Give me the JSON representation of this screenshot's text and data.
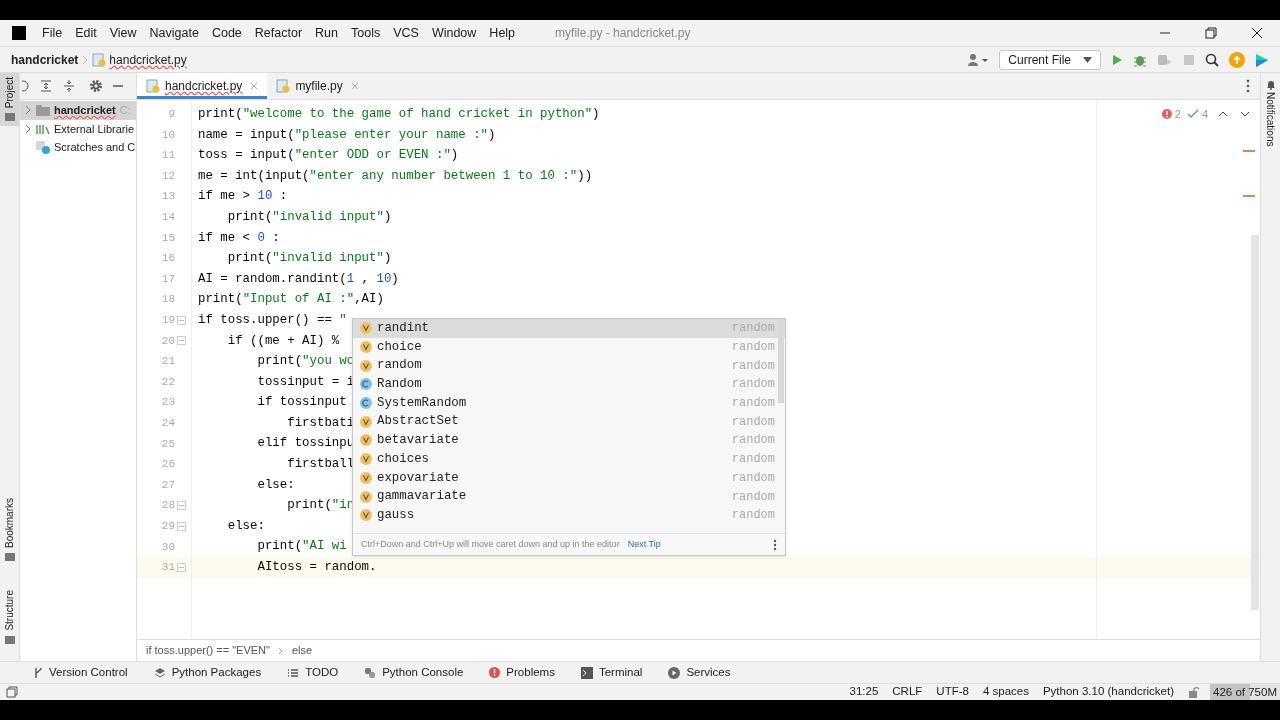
{
  "menu": [
    "File",
    "Edit",
    "View",
    "Navigate",
    "Code",
    "Refactor",
    "Run",
    "Tools",
    "VCS",
    "Window",
    "Help"
  ],
  "window": {
    "title": "myfile.py - handcricket.py"
  },
  "navbar": {
    "project": "handcricket",
    "file": "handcricket.py",
    "run_config": "Current File"
  },
  "left_stripe": [
    "Project",
    "Bookmarks",
    "Structure"
  ],
  "right_stripe": [
    "Notifications"
  ],
  "project_tree": [
    {
      "label": "handcricket",
      "suffix": "C:",
      "kind": "folder",
      "expanded": false,
      "selected": true
    },
    {
      "label": "External Librarie",
      "kind": "libs",
      "expanded": false,
      "selected": false
    },
    {
      "label": "Scratches and C",
      "kind": "scratch",
      "selected": false
    }
  ],
  "tabs": [
    {
      "label": "handcricket.py",
      "selected": true
    },
    {
      "label": "myfile.py",
      "selected": false
    }
  ],
  "inspections": {
    "errors": "2",
    "warnings": "4"
  },
  "code": [
    {
      "n": "9",
      "fold": false,
      "current": false,
      "tokens": [
        {
          "t": "print(",
          "kind": "plain"
        },
        {
          "t": "\"welcome to the game of hand cricket in python\"",
          "kind": "string"
        },
        {
          "t": ")",
          "kind": "plain"
        }
      ]
    },
    {
      "n": "10",
      "fold": false,
      "current": false,
      "tokens": [
        {
          "t": "name = input(",
          "kind": "plain"
        },
        {
          "t": "\"please enter your name :\"",
          "kind": "string"
        },
        {
          "t": ")",
          "kind": "plain"
        }
      ]
    },
    {
      "n": "11",
      "fold": false,
      "current": false,
      "tokens": [
        {
          "t": "toss = input(",
          "kind": "plain"
        },
        {
          "t": "\"enter ODD or EVEN :\"",
          "kind": "string"
        },
        {
          "t": ")",
          "kind": "plain"
        }
      ]
    },
    {
      "n": "12",
      "fold": false,
      "current": false,
      "tokens": [
        {
          "t": "me = int(input(",
          "kind": "plain"
        },
        {
          "t": "\"enter any number between 1 to 10 :\"",
          "kind": "string"
        },
        {
          "t": "))",
          "kind": "plain"
        }
      ]
    },
    {
      "n": "13",
      "fold": false,
      "current": false,
      "tokens": [
        {
          "t": "if me > ",
          "kind": "plain"
        },
        {
          "t": "10",
          "kind": "number"
        },
        {
          "t": " :",
          "kind": "plain"
        }
      ]
    },
    {
      "n": "14",
      "fold": false,
      "current": false,
      "tokens": [
        {
          "t": "    print(",
          "kind": "plain"
        },
        {
          "t": "\"invalid input\"",
          "kind": "string"
        },
        {
          "t": ")",
          "kind": "plain"
        }
      ]
    },
    {
      "n": "15",
      "fold": false,
      "current": false,
      "tokens": [
        {
          "t": "if me < ",
          "kind": "plain"
        },
        {
          "t": "0",
          "kind": "number"
        },
        {
          "t": " :",
          "kind": "plain"
        }
      ]
    },
    {
      "n": "16",
      "fold": false,
      "current": false,
      "tokens": [
        {
          "t": "    print(",
          "kind": "plain"
        },
        {
          "t": "\"invalid input\"",
          "kind": "string"
        },
        {
          "t": ")",
          "kind": "plain"
        }
      ]
    },
    {
      "n": "17",
      "fold": false,
      "current": false,
      "tokens": [
        {
          "t": "AI = random.randint(",
          "kind": "plain"
        },
        {
          "t": "1",
          "kind": "number"
        },
        {
          "t": " , ",
          "kind": "plain"
        },
        {
          "t": "10",
          "kind": "number"
        },
        {
          "t": ")",
          "kind": "plain"
        }
      ]
    },
    {
      "n": "18",
      "fold": false,
      "current": false,
      "tokens": [
        {
          "t": "print(",
          "kind": "plain"
        },
        {
          "t": "\"Input of AI :\"",
          "kind": "string"
        },
        {
          "t": ",AI)",
          "kind": "plain"
        }
      ]
    },
    {
      "n": "19",
      "fold": true,
      "current": false,
      "tokens": [
        {
          "t": "if toss.upper() == ",
          "kind": "plain"
        },
        {
          "t": "\"",
          "kind": "string"
        }
      ]
    },
    {
      "n": "20",
      "fold": true,
      "current": false,
      "tokens": [
        {
          "t": "    if ((me + AI) % ",
          "kind": "plain"
        }
      ]
    },
    {
      "n": "21",
      "fold": false,
      "current": false,
      "tokens": [
        {
          "t": "        print(",
          "kind": "plain"
        },
        {
          "t": "\"you wo",
          "kind": "string"
        }
      ]
    },
    {
      "n": "22",
      "fold": false,
      "current": false,
      "tokens": [
        {
          "t": "        tossinput = i",
          "kind": "plain"
        }
      ]
    },
    {
      "n": "23",
      "fold": false,
      "current": false,
      "tokens": [
        {
          "t": "        if tossinput ",
          "kind": "plain"
        }
      ]
    },
    {
      "n": "24",
      "fold": false,
      "current": false,
      "tokens": [
        {
          "t": "            firstbati",
          "kind": "plain"
        }
      ]
    },
    {
      "n": "25",
      "fold": false,
      "current": false,
      "tokens": [
        {
          "t": "        elif tossinpu",
          "kind": "plain"
        }
      ]
    },
    {
      "n": "26",
      "fold": false,
      "current": false,
      "tokens": [
        {
          "t": "            firstball",
          "kind": "plain"
        }
      ]
    },
    {
      "n": "27",
      "fold": false,
      "current": false,
      "tokens": [
        {
          "t": "        else:",
          "kind": "plain"
        }
      ]
    },
    {
      "n": "28",
      "fold": true,
      "current": false,
      "tokens": [
        {
          "t": "            print(",
          "kind": "plain"
        },
        {
          "t": "\"in",
          "kind": "string"
        }
      ]
    },
    {
      "n": "29",
      "fold": true,
      "current": false,
      "tokens": [
        {
          "t": "    else:",
          "kind": "plain"
        }
      ]
    },
    {
      "n": "30",
      "fold": false,
      "current": false,
      "tokens": [
        {
          "t": "        print(",
          "kind": "plain"
        },
        {
          "t": "\"AI wi",
          "kind": "string"
        }
      ]
    },
    {
      "n": "31",
      "fold": true,
      "current": true,
      "tokens": [
        {
          "t": "        AItoss = random.",
          "kind": "plain"
        }
      ]
    }
  ],
  "completion": {
    "items": [
      {
        "kind": "variable",
        "label": "randint",
        "source": "random",
        "selected": true
      },
      {
        "kind": "variable",
        "label": "choice",
        "source": "random",
        "selected": false
      },
      {
        "kind": "variable",
        "label": "random",
        "source": "random",
        "selected": false
      },
      {
        "kind": "class",
        "label": "Random",
        "source": "random",
        "selected": false
      },
      {
        "kind": "class",
        "label": "SystemRandom",
        "source": "random",
        "selected": false
      },
      {
        "kind": "variable",
        "label": "AbstractSet",
        "source": "random",
        "selected": false
      },
      {
        "kind": "variable",
        "label": "betavariate",
        "source": "random",
        "selected": false
      },
      {
        "kind": "variable",
        "label": "choices",
        "source": "random",
        "selected": false
      },
      {
        "kind": "variable",
        "label": "expovariate",
        "source": "random",
        "selected": false
      },
      {
        "kind": "variable",
        "label": "gammavariate",
        "source": "random",
        "selected": false
      },
      {
        "kind": "variable",
        "label": "gauss",
        "source": "random",
        "selected": false
      }
    ],
    "hint": "Ctrl+Down and Ctrl+Up will move caret down and up in the editor",
    "hint_link": "Next Tip"
  },
  "breadcrumbs": [
    "if toss.upper() == \"EVEN\"",
    "else"
  ],
  "tool_windows": [
    {
      "label": "Version Control",
      "kind": "vcs"
    },
    {
      "label": "Python Packages",
      "kind": "packages"
    },
    {
      "label": "TODO",
      "kind": "todo"
    },
    {
      "label": "Python Console",
      "kind": "console"
    },
    {
      "label": "Problems",
      "kind": "problems"
    },
    {
      "label": "Terminal",
      "kind": "terminal"
    },
    {
      "label": "Services",
      "kind": "services"
    }
  ],
  "status_bar": {
    "position": "31:25",
    "line_sep": "CRLF",
    "encoding": "UTF-8",
    "indent": "4 spaces",
    "interpreter": "Python 3.10 (handcricket)",
    "memory": {
      "text": "426 of 750M",
      "level": 0.57
    }
  }
}
